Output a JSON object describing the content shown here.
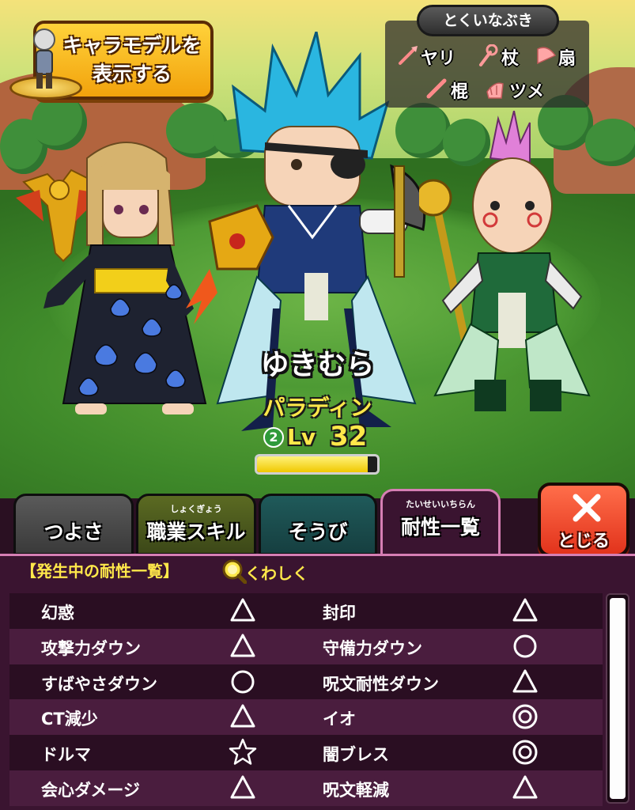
{
  "model_button": {
    "label_line1": "キャラモデルを",
    "label_line2": "表示する"
  },
  "special_weapons": {
    "title": "とくいなぶき",
    "items": [
      {
        "label": "ヤリ",
        "icon": "spear-icon"
      },
      {
        "label": "杖",
        "icon": "staff-icon"
      },
      {
        "label": "扇",
        "icon": "fan-icon"
      },
      {
        "label": "棍",
        "icon": "club-icon"
      },
      {
        "label": "ツメ",
        "icon": "claw-icon"
      }
    ]
  },
  "character": {
    "name": "ゆきむら",
    "job": "パラディン",
    "rank": "2",
    "level_label": "Lv",
    "level": "32",
    "exp_fraction": 0.92
  },
  "tabs": [
    {
      "label": "つよさ",
      "ruby": ""
    },
    {
      "label": "職業スキル",
      "ruby": "しょくぎょう"
    },
    {
      "label": "そうび",
      "ruby": ""
    },
    {
      "label": "耐性一覧",
      "ruby": "たいせいいちらん"
    }
  ],
  "active_tab": 3,
  "close_button": {
    "label": "とじる"
  },
  "panel": {
    "header": "【発生中の耐性一覧】",
    "detail_label": "くわしく"
  },
  "resistances": [
    {
      "left": "幻惑",
      "left_mark": "triangle",
      "right": "封印",
      "right_mark": "triangle"
    },
    {
      "left": "攻撃力ダウン",
      "left_mark": "triangle",
      "right": "守備力ダウン",
      "right_mark": "circle"
    },
    {
      "left": "すばやさダウン",
      "left_mark": "circle",
      "right": "呪文耐性ダウン",
      "right_mark": "triangle"
    },
    {
      "left": "CT減少",
      "left_mark": "triangle",
      "right": "イオ",
      "right_mark": "double-circle"
    },
    {
      "left": "ドルマ",
      "left_mark": "star",
      "right": "闇ブレス",
      "right_mark": "double-circle"
    },
    {
      "left": "会心ダメージ",
      "left_mark": "triangle",
      "right": "呪文軽減",
      "right_mark": "triangle"
    }
  ],
  "colors": {
    "accent_yellow": "#ffe84a",
    "panel_bg": "#3a1430",
    "row_dark": "#2a0e22",
    "row_light": "#4a1d3e",
    "close_red": "#e2331c"
  }
}
